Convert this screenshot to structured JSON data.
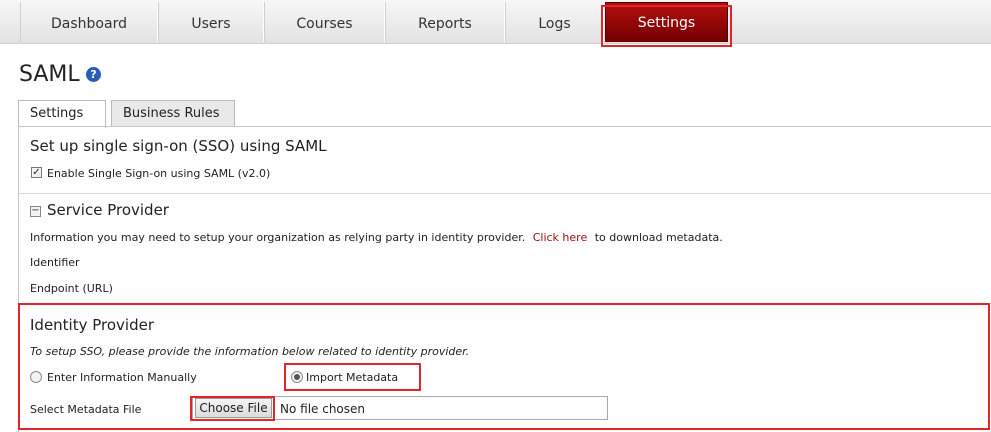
{
  "nav": {
    "tabs": [
      {
        "label": "Dashboard"
      },
      {
        "label": "Users"
      },
      {
        "label": "Courses"
      },
      {
        "label": "Reports"
      },
      {
        "label": "Logs"
      },
      {
        "label": "Settings"
      }
    ],
    "active": "Settings"
  },
  "page": {
    "title": "SAML",
    "help_icon": "?"
  },
  "subtabs": [
    {
      "label": "Settings"
    },
    {
      "label": "Business Rules"
    }
  ],
  "sso": {
    "heading": "Set up single sign-on (SSO) using SAML",
    "enable_label": "Enable Single Sign-on using SAML (v2.0)",
    "enable_checked": true
  },
  "service_provider": {
    "heading": "Service Provider",
    "info_text": "Information you may need to setup your organization as relying party in identity provider.",
    "link_text": "Click here",
    "link_suffix": "to download metadata.",
    "identifier_label": "Identifier",
    "endpoint_label": "Endpoint (URL)"
  },
  "identity_provider": {
    "heading": "Identity Provider",
    "instruction": "To setup SSO, please provide the information below related to identity provider.",
    "option_manual": "Enter Information Manually",
    "option_import": "Import Metadata",
    "selected": "Import Metadata",
    "file_label": "Select Metadata File",
    "choose_button": "Choose File",
    "file_status": "No file chosen"
  },
  "colors": {
    "accent": "#8b0000",
    "highlight": "#e0262b",
    "link": "#a01010"
  }
}
